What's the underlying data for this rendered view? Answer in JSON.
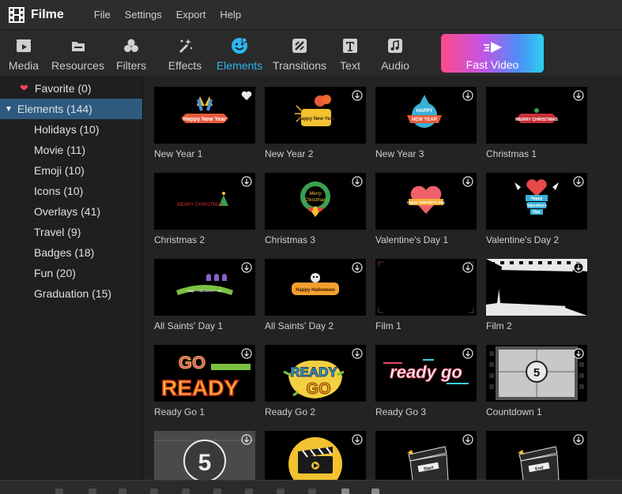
{
  "app": {
    "title": "Filme"
  },
  "menu": [
    "File",
    "Settings",
    "Export",
    "Help"
  ],
  "toolbar": [
    {
      "label": "Media",
      "icon": "media-icon"
    },
    {
      "label": "Resources",
      "icon": "resources-icon"
    },
    {
      "label": "Filters",
      "icon": "filters-icon"
    },
    {
      "label": "Effects",
      "icon": "effects-icon"
    },
    {
      "label": "Elements",
      "icon": "elements-icon",
      "active": true
    },
    {
      "label": "Transitions",
      "icon": "transitions-icon"
    },
    {
      "label": "Text",
      "icon": "text-icon"
    },
    {
      "label": "Audio",
      "icon": "audio-icon"
    }
  ],
  "fast_video": {
    "label": "Fast Video"
  },
  "sidebar": {
    "favorite": "Favorite (0)",
    "elements": "Elements (144)",
    "items": [
      "Holidays (10)",
      "Movie (11)",
      "Emoji (10)",
      "Icons (10)",
      "Overlays (41)",
      "Travel (9)",
      "Badges (18)",
      "Fun (20)",
      "Graduation (15)"
    ]
  },
  "grid": {
    "items": [
      "New Year 1",
      "New Year 2",
      "New Year 3",
      "Christmas 1",
      "Christmas 2",
      "Christmas 3",
      "Valentine's Day 1",
      "Valentine's Day 2",
      "All Saints' Day 1",
      "All Saints' Day 2",
      "Film 1",
      "Film 2",
      "Ready Go 1",
      "Ready Go 2",
      "Ready Go 3",
      "Countdown 1",
      "",
      "",
      "",
      ""
    ],
    "thumb_text": {
      "new_year_1": "Happy New Year",
      "new_year_2": "Happy New Year",
      "new_year_3a": "HAPPY",
      "new_year_3b": "NEW YEAR",
      "christmas_1": "MERRY CHRISTMAS",
      "christmas_2": "MERRY CHRISTMAS",
      "christmas_3a": "Merry",
      "christmas_3b": "Christmas",
      "valentine_1": "Happy Valentine's Day",
      "valentine_2a": "Happy",
      "valentine_2b": "Valentine's",
      "valentine_2c": "Day",
      "saints_1": "Hap - Halloween - cat",
      "saints_2": "Happy Halloween",
      "ready_1a": "GO",
      "ready_1b": "READY",
      "ready_2a": "READY",
      "ready_2b": "GO",
      "ready_3": "ready go",
      "countdown_1": "5",
      "countdown_2": "5",
      "clap_1": "Start",
      "clap_2": "End"
    }
  },
  "colors": {
    "accent": "#2eb5f0",
    "selection": "#2e5a80",
    "heart": "#f0435a"
  }
}
